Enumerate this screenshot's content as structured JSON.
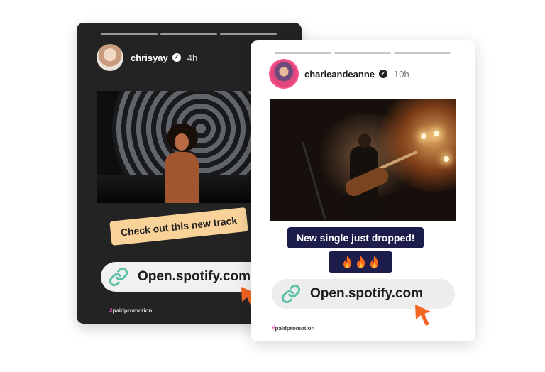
{
  "dark_story": {
    "username": "chrisyay",
    "verified_mark": "✓",
    "time": "4h",
    "progress_segments": 3,
    "caption": "Check out this new track",
    "link_text": "Open.spotify.com",
    "hashtag_symbol": "#",
    "hashtag_text": "paidpromotion",
    "icons": [
      "avatar",
      "verified-badge-icon",
      "link-icon",
      "cursor-arrow-icon"
    ]
  },
  "light_story": {
    "username": "charleandeanne",
    "verified_mark": "✓",
    "time": "10h",
    "progress_segments": 3,
    "caption": "New single just dropped!",
    "emoji_count": 3,
    "link_text": "Open.spotify.com",
    "hashtag_symbol": "#",
    "hashtag_text": "paidpromotion",
    "icons": [
      "avatar",
      "verified-badge-icon",
      "fire-icon",
      "link-icon",
      "cursor-arrow-icon"
    ]
  },
  "colors": {
    "dark_card_bg": "#232323",
    "caption_tag_bg": "#f9d29a",
    "caption_box_bg": "#1c1d4a",
    "link_icon": "#5ec2a8",
    "cursor": "#f26522",
    "hashtag_hash": "#e94bb6",
    "avatar_ring": "#ff4f8b"
  }
}
